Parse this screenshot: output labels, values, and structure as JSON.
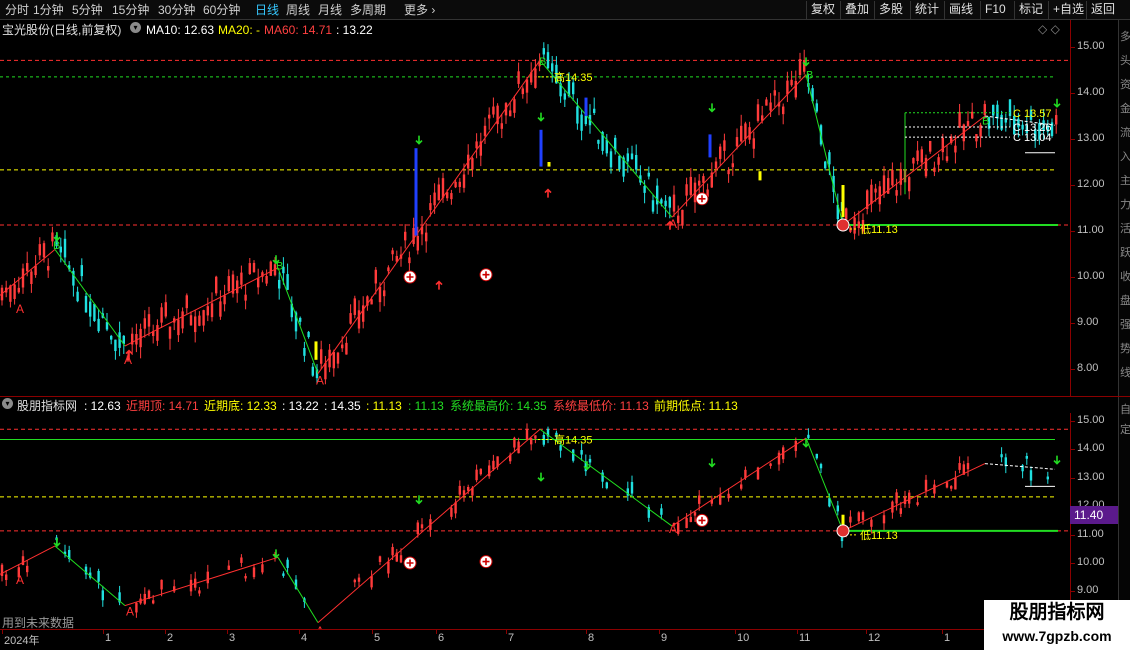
{
  "toolbar": {
    "timeframes": [
      "分时",
      "1分钟",
      "5分钟",
      "15分钟",
      "30分钟",
      "60分钟",
      "日线",
      "周线",
      "月线",
      "多周期",
      "更多"
    ],
    "active": "日线",
    "buttons": [
      "复权",
      "叠加",
      "多股",
      "统计",
      "画线",
      "F10",
      "标记",
      "+自选",
      "返回"
    ]
  },
  "main_legend": {
    "stock": "宝光股份(日线,前复权)",
    "ma10": "MA10: 12.63",
    "ma20": "MA20: -",
    "ma60": "MA60: 14.71",
    "extra": ": 13.22"
  },
  "top_controls": "◇ ◇",
  "sub_legend": {
    "name": "股朋指标网",
    "v1": ": 12.63",
    "recent_top": "近期顶: 14.71",
    "recent_bottom": "近期底: 12.33",
    "v2": ": 13.22",
    "v3": ": 14.35",
    "v4": ": 11.13",
    "v5": ": 11.13",
    "sys_high": "系统最高价: 14.35",
    "sys_low": "系统最低价: 11.13",
    "prev_low": "前期低点: 11.13"
  },
  "annotations": {
    "high": "高14.35",
    "low": "低11.13",
    "c1": "C 13.57",
    "c2": "C 13.26",
    "c3": "C 13.04",
    "high2": "高14.35",
    "low2": "低11.13",
    "buy": "B",
    "sell": "A",
    "fut_hint": "用到未来数据"
  },
  "main_axis": [
    "15.00",
    "14.00",
    "13.00",
    "12.00",
    "11.00",
    "10.00",
    "9.00",
    "8.00"
  ],
  "sub_axis": [
    "15.00",
    "14.00",
    "13.00",
    "12.00",
    "11.00",
    "10.00",
    "9.00"
  ],
  "price_badge": "11.40",
  "date_axis": [
    "2024年",
    "1",
    "2",
    "3",
    "4",
    "5",
    "6",
    "7",
    "8",
    "9",
    "10",
    "11",
    "12",
    "1"
  ],
  "side_strip_main": [
    "多",
    "头",
    "资",
    "金",
    "流",
    "入",
    "主",
    "力",
    "活",
    "跃",
    "收",
    "盘",
    "强",
    "势",
    "线"
  ],
  "side_strip_sub": [
    "自",
    "定"
  ],
  "watermark": {
    "title": "股朋指标网",
    "url": "www.7gpzb.com"
  },
  "colors": {
    "up": "#ff3b3b",
    "down": "#20e0e0",
    "zigzag_up": "#ff3030",
    "zigzag_down": "#20e020",
    "yellow": "#ffff00",
    "blue": "#2040ff",
    "green": "#22dd22"
  },
  "chart_data": {
    "type": "line",
    "title": "宝光股份(日线,前复权)",
    "xlabel": "",
    "ylabel": "",
    "ylim": [
      7.5,
      15.3
    ],
    "x": [
      "2024-01",
      "2024-02",
      "2024-03",
      "2024-04",
      "2024-05",
      "2024-06",
      "2024-07",
      "2024-08",
      "2024-09",
      "2024-10",
      "2024-11",
      "2024-12",
      "2025-01"
    ],
    "series": [
      {
        "name": "zigzag",
        "points": [
          {
            "x": 0,
            "y": 9.6
          },
          {
            "x": 55,
            "y": 10.6
          },
          {
            "x": 125,
            "y": 8.5
          },
          {
            "x": 278,
            "y": 10.2
          },
          {
            "x": 318,
            "y": 7.9
          },
          {
            "x": 540,
            "y": 14.71
          },
          {
            "x": 672,
            "y": 11.3
          },
          {
            "x": 806,
            "y": 14.4
          },
          {
            "x": 843,
            "y": 11.13
          },
          {
            "x": 985,
            "y": 13.5
          },
          {
            "x": 1055,
            "y": 13.3
          }
        ]
      }
    ],
    "levels": [
      {
        "name": "近期顶",
        "y": 14.71,
        "color": "red"
      },
      {
        "name": "系统最高价",
        "y": 14.35,
        "color": "green"
      },
      {
        "name": "近期底",
        "y": 12.33,
        "color": "yellow"
      },
      {
        "name": "系统最低价",
        "y": 11.13,
        "color": "red"
      },
      {
        "name": "前期低点",
        "y": 11.13,
        "color": "green"
      }
    ],
    "grid": false
  }
}
